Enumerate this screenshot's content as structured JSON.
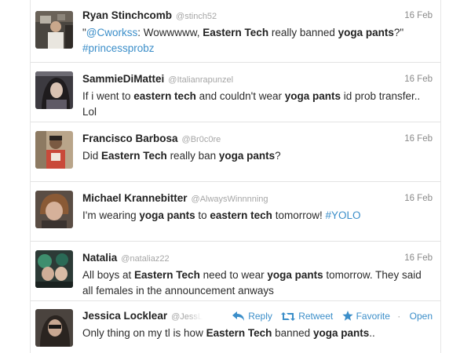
{
  "tweets": [
    {
      "name": "Ryan Stinchcomb",
      "handle": "@stinch52",
      "date": "16 Feb",
      "mention": "@Cworkss",
      "part1": ": Wowwwww, ",
      "bold1": "Eastern Tech",
      "part2": " really banned ",
      "bold2": "yoga pants",
      "part3": "?\"",
      "hashtag": "#princessprobz",
      "quote_open": "\""
    },
    {
      "name": "SammieDiMattei",
      "handle": "@Italianrapunzel",
      "date": "16 Feb",
      "part1": "If i went to ",
      "bold1": "eastern tech",
      "part2": " and couldn't wear ",
      "bold2": "yoga pants",
      "part3": " id prob transfer.. Lol"
    },
    {
      "name": "Francisco Barbosa",
      "handle": "@Br0c0re",
      "date": "16 Feb",
      "part1": "Did ",
      "bold1": "Eastern Tech",
      "part2": " really ban ",
      "bold2": "yoga pants",
      "part3": "?"
    },
    {
      "name": "Michael Krannebitter",
      "handle": "@AlwaysWinnnning",
      "date": "16 Feb",
      "part1": "I'm wearing ",
      "bold1": "yoga pants",
      "part2": " to ",
      "bold2": "eastern tech",
      "part3": " tomorrow! ",
      "hashtag": "#YOLO"
    },
    {
      "name": "Natalia",
      "handle": "@nataliaz22",
      "date": "16 Feb",
      "part1": "All boys at ",
      "bold1": "Eastern Tech",
      "part2": " need to wear ",
      "bold2": "yoga pants",
      "part3": " tomorrow. They said all females in the announcement anways"
    },
    {
      "name": "Jessica Locklear",
      "handle": "@JessL",
      "part1": "Only thing on my tl is how ",
      "bold1": "Eastern Tech",
      "part2": " banned ",
      "bold2": "yoga pants",
      "part3": ".."
    }
  ],
  "actions": {
    "reply": "Reply",
    "retweet": "Retweet",
    "favorite": "Favorite",
    "open": "Open",
    "separator": "·"
  },
  "colors": {
    "link": "#3b8ec9",
    "name": "#222222",
    "handle": "#a6a6a6",
    "divider": "#e3e3e3"
  },
  "icons": {
    "reply": "reply-arrow-icon",
    "retweet": "retweet-icon",
    "favorite": "star-icon"
  }
}
